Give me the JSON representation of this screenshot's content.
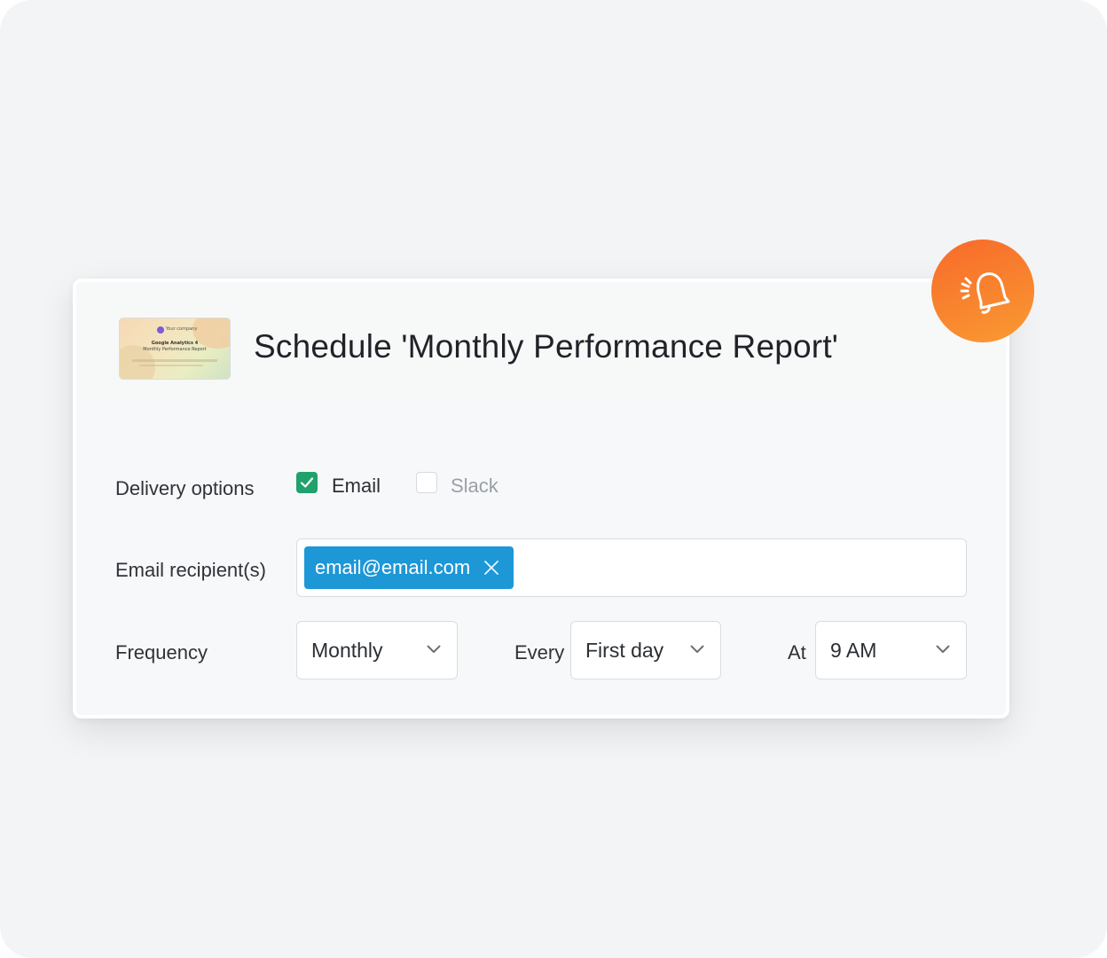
{
  "dialog": {
    "title": "Schedule 'Monthly Performance Report'",
    "thumbnail": {
      "brand": "Your company",
      "line1": "Google Analytics 4",
      "line2": "Monthly Performance Report"
    }
  },
  "delivery": {
    "label": "Delivery options",
    "options": [
      {
        "label": "Email",
        "checked": true
      },
      {
        "label": "Slack",
        "checked": false
      }
    ]
  },
  "recipients": {
    "label": "Email recipient(s)",
    "chips": [
      {
        "label": "email@email.com"
      }
    ]
  },
  "frequency": {
    "label": "Frequency",
    "value": "Monthly",
    "every_label": "Every",
    "every_value": "First day",
    "at_label": "At",
    "at_value": "9 AM"
  },
  "icons": {
    "bell": "bell-ringing-icon",
    "check": "check-icon",
    "close": "close-icon",
    "chevron": "chevron-down-icon"
  },
  "colors": {
    "checkbox_checked": "#21a16b",
    "chip": "#1d97d6",
    "badge_start": "#f86a2a",
    "badge_end": "#f99a32",
    "slack_disabled_text": "#9aa0a6"
  }
}
